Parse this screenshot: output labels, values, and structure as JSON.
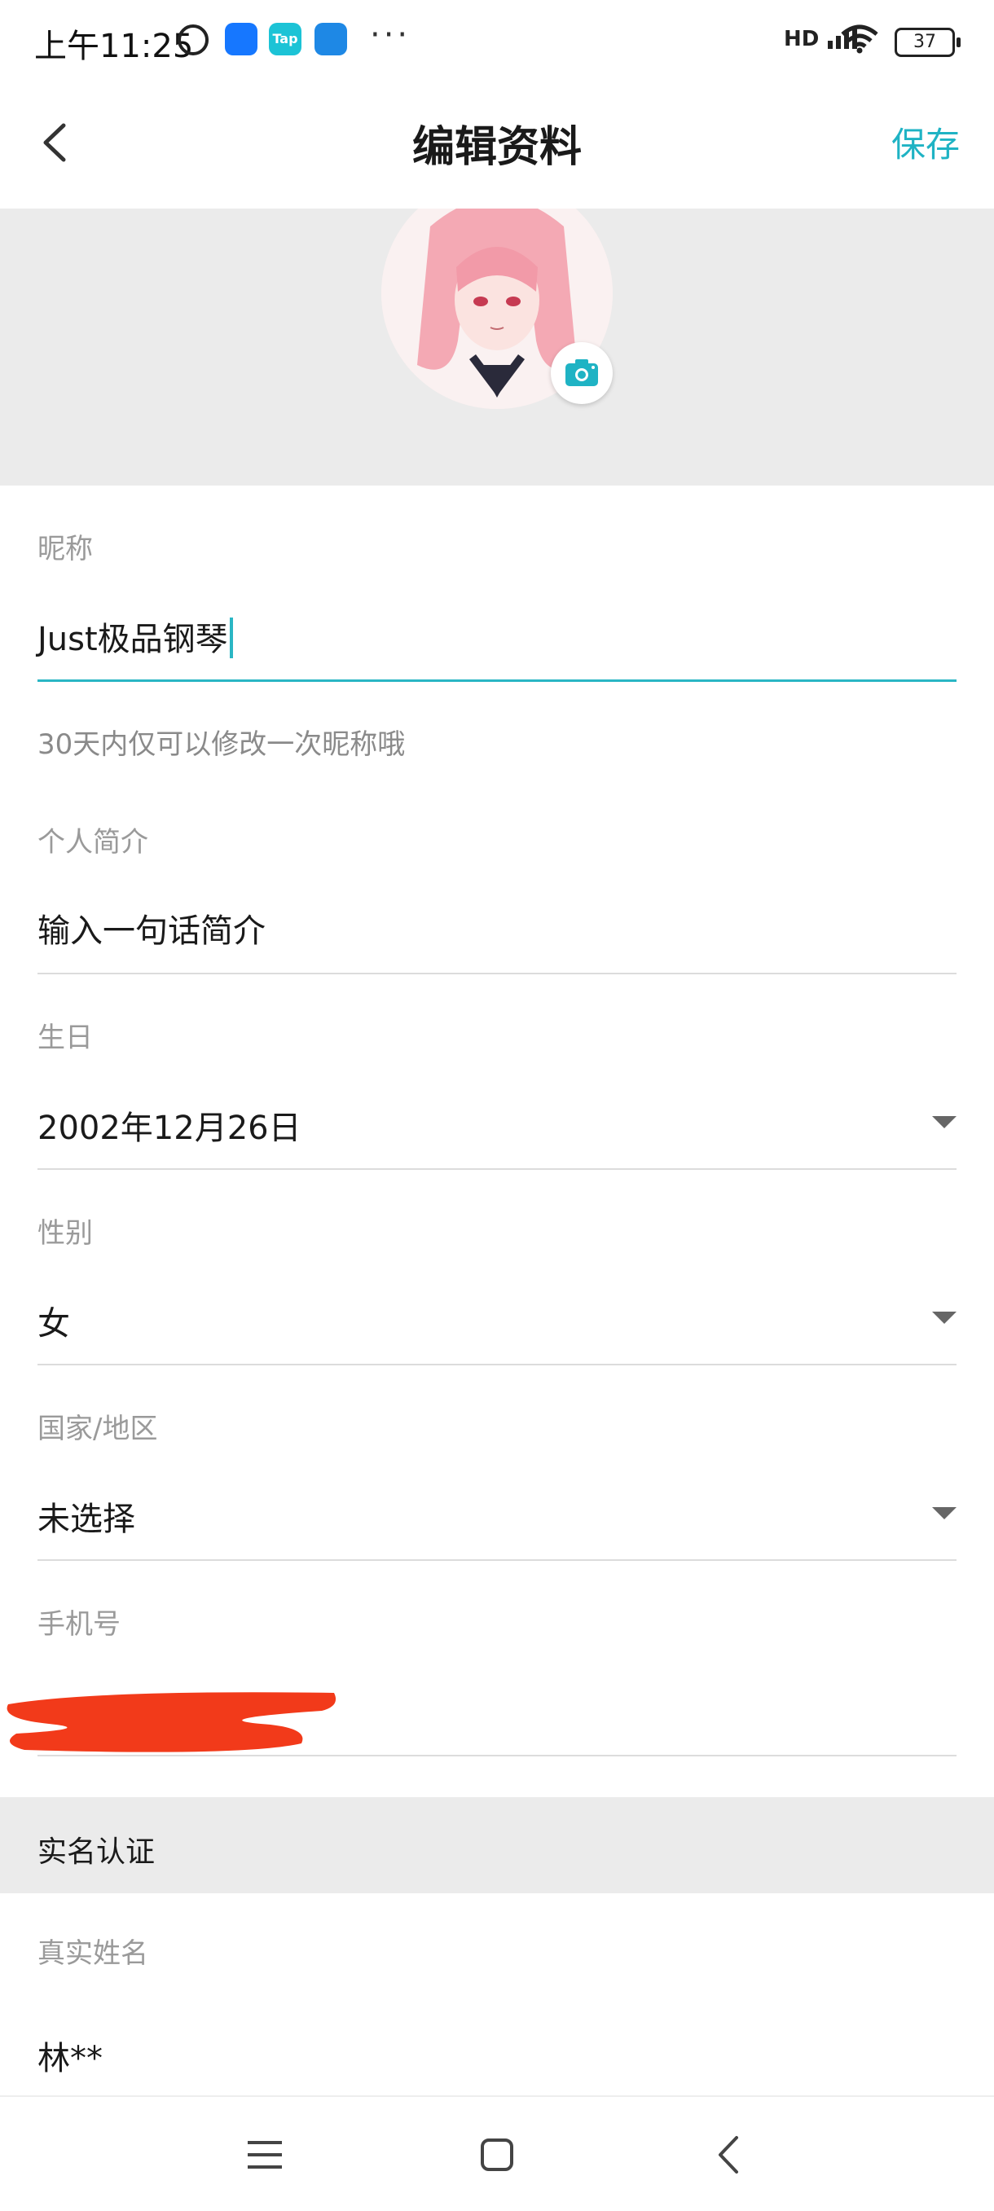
{
  "status_bar": {
    "time": "上午11:25",
    "tap_label": "Tap",
    "more": "···",
    "signal_label": "HD",
    "battery": "37"
  },
  "header": {
    "title": "编辑资料",
    "save_label": "保存"
  },
  "colors": {
    "accent": "#1fb3c4",
    "divider": "#dcdcdc",
    "section_bg": "#ebebeb",
    "redaction": "#f23a1a"
  },
  "form": {
    "nickname": {
      "label": "昵称",
      "value": "Just极品钢琴",
      "hint": "30天内仅可以修改一次昵称哦"
    },
    "bio": {
      "label": "个人简介",
      "placeholder": "输入一句话简介"
    },
    "birthday": {
      "label": "生日",
      "value": "2002年12月26日"
    },
    "gender": {
      "label": "性别",
      "value": "女"
    },
    "region": {
      "label": "国家/地区",
      "value": "未选择"
    },
    "phone": {
      "label": "手机号",
      "value": ""
    }
  },
  "real_name_section": {
    "title": "实名认证",
    "real_name_label": "真实姓名",
    "real_name_value": "林**"
  },
  "nav": {
    "icons": [
      "menu-icon",
      "home-icon",
      "back-icon"
    ]
  }
}
